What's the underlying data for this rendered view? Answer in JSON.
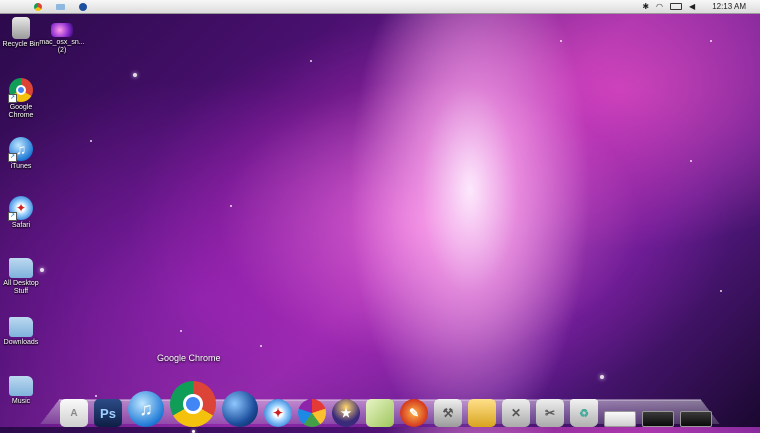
{
  "menubar": {
    "clock": "12:13 AM",
    "left_icons": [
      "apple-icon",
      "chrome-icon",
      "folder-icon",
      "globe-icon"
    ],
    "status_icons": [
      "bluetooth-icon",
      "wifi-icon",
      "battery-icon",
      "volume-icon"
    ]
  },
  "desktop": {
    "icons": [
      {
        "id": "recycle-bin",
        "label": "Recycle Bin",
        "icon": "recycle-bin-icon"
      },
      {
        "id": "mac-osx-screenshot",
        "label": "mac_osx_sn... (2)",
        "icon": "image-file-icon"
      },
      {
        "id": "google-chrome",
        "label": "Google Chrome",
        "icon": "chrome-icon"
      },
      {
        "id": "itunes",
        "label": "iTunes",
        "icon": "itunes-icon"
      },
      {
        "id": "safari",
        "label": "Safari",
        "icon": "safari-icon"
      },
      {
        "id": "all-desktop-stuff",
        "label": "All Desktop Stuff",
        "icon": "folder-icon"
      },
      {
        "id": "downloads",
        "label": "Downloads",
        "icon": "folder-icon"
      },
      {
        "id": "music",
        "label": "Music",
        "icon": "folder-icon"
      }
    ]
  },
  "dock": {
    "tooltip": "Google Chrome",
    "items": [
      {
        "id": "textedit",
        "icon": "text-document-icon",
        "glyph": "A"
      },
      {
        "id": "photoshop",
        "icon": "photoshop-icon",
        "glyph": "Ps"
      },
      {
        "id": "itunes",
        "icon": "itunes-icon",
        "glyph": "♫"
      },
      {
        "id": "chrome",
        "icon": "chrome-icon",
        "glyph": ""
      },
      {
        "id": "network",
        "icon": "globe-icon",
        "glyph": ""
      },
      {
        "id": "safari",
        "icon": "safari-icon",
        "glyph": "✦"
      },
      {
        "id": "picasa",
        "icon": "picasa-icon",
        "glyph": ""
      },
      {
        "id": "wizard",
        "icon": "wizard-icon",
        "glyph": "★"
      },
      {
        "id": "paper",
        "icon": "paper-icon",
        "glyph": ""
      },
      {
        "id": "paint",
        "icon": "paint-brush-icon",
        "glyph": "✎"
      },
      {
        "id": "utilities",
        "icon": "utilities-icon",
        "glyph": "⚒"
      },
      {
        "id": "folder",
        "icon": "folder-icon",
        "glyph": ""
      },
      {
        "id": "system-tools",
        "icon": "tools-icon",
        "glyph": "✕"
      },
      {
        "id": "system-tools-2",
        "icon": "tools-icon",
        "glyph": "✂"
      },
      {
        "id": "trash",
        "icon": "recycle-bin-icon",
        "glyph": "♻"
      },
      {
        "id": "device-1",
        "icon": "device-icon",
        "glyph": ""
      },
      {
        "id": "device-2",
        "icon": "device-icon",
        "glyph": ""
      },
      {
        "id": "device-3",
        "icon": "device-icon",
        "glyph": ""
      }
    ]
  }
}
